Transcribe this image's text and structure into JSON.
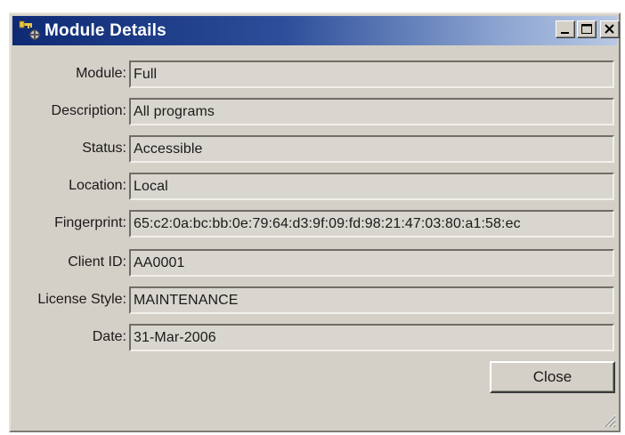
{
  "window": {
    "title": "Module Details"
  },
  "fields": [
    {
      "label": "Module:",
      "value": "Full"
    },
    {
      "label": "Description:",
      "value": "All programs"
    },
    {
      "label": "Status:",
      "value": "Accessible"
    },
    {
      "label": "Location:",
      "value": "Local"
    },
    {
      "label": "Fingerprint:",
      "value": "65:c2:0a:bc:bb:0e:79:64:d3:9f:09:fd:98:21:47:03:80:a1:58:ec"
    },
    {
      "label": "Client ID:",
      "value": "AA0001"
    },
    {
      "label": "License Style:",
      "value": "MAINTENANCE"
    },
    {
      "label": "Date:",
      "value": "31-Mar-2006"
    }
  ],
  "buttons": {
    "close_label": "Close"
  },
  "icons": {
    "window_icon": "key-module-icon",
    "minimize": "minimize-icon",
    "maximize": "maximize-icon",
    "close": "close-icon",
    "grip": "resize-grip-icon"
  },
  "colors": {
    "titlebar_start": "#0e2a74",
    "titlebar_end": "#b8c8e4",
    "window_bg": "#d4d0c8"
  }
}
